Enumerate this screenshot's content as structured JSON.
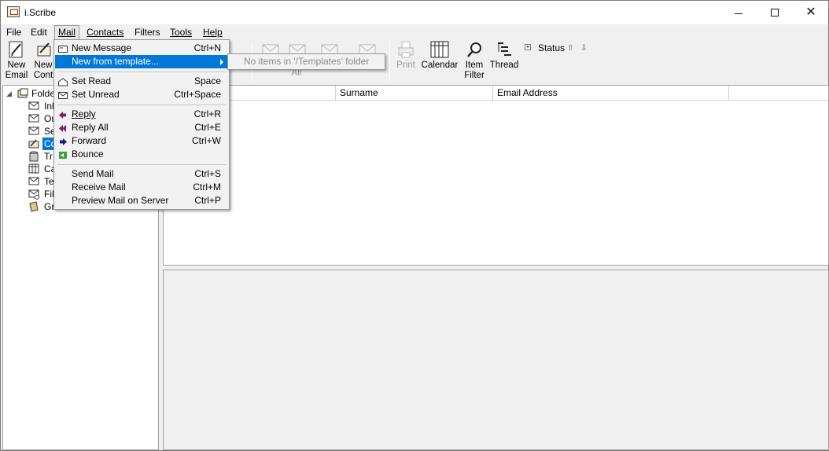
{
  "window": {
    "title": "i.Scribe"
  },
  "menubar": [
    "File",
    "Edit",
    "Mail",
    "Contacts",
    "Filters",
    "Tools",
    "Help"
  ],
  "toolbar": {
    "new_email": [
      "New",
      "Email"
    ],
    "new_contact": [
      "New",
      "Cont"
    ],
    "all_label": "All",
    "print": "Print",
    "calendar": "Calendar",
    "item_filter": [
      "Item",
      "Filter"
    ],
    "thread": "Thread",
    "status": "Status"
  },
  "tree": {
    "root": "Folde",
    "items": [
      "Inb",
      "Ou",
      "Se",
      "Co",
      "Tr",
      "Ca",
      "Te",
      "Fil",
      "Gr"
    ]
  },
  "list": {
    "columns": [
      "Surname",
      "Email Address"
    ]
  },
  "mail_menu": {
    "groups": [
      [
        {
          "label": "New Message",
          "shortcut": "Ctrl+N",
          "icon": "envelope-icon"
        },
        {
          "label": "New from template...",
          "shortcut": "",
          "icon": "",
          "highlighted": true,
          "submenu": true
        }
      ],
      [
        {
          "label": "Set Read",
          "shortcut": "Space",
          "icon": "open-envelope-icon"
        },
        {
          "label": "Set Unread",
          "shortcut": "Ctrl+Space",
          "icon": "closed-envelope-icon"
        }
      ],
      [
        {
          "label": "Reply",
          "shortcut": "Ctrl+R",
          "icon": "reply-icon"
        },
        {
          "label": "Reply All",
          "shortcut": "Ctrl+E",
          "icon": "reply-all-icon"
        },
        {
          "label": "Forward",
          "shortcut": "Ctrl+W",
          "icon": "forward-icon"
        },
        {
          "label": "Bounce",
          "shortcut": "",
          "icon": "bounce-icon"
        }
      ],
      [
        {
          "label": "Send Mail",
          "shortcut": "Ctrl+S",
          "icon": ""
        },
        {
          "label": "Receive Mail",
          "shortcut": "Ctrl+M",
          "icon": ""
        },
        {
          "label": "Preview Mail on Server",
          "shortcut": "Ctrl+P",
          "icon": ""
        }
      ]
    ]
  },
  "template_submenu": {
    "text": "No items in '/Templates' folder"
  },
  "colors": {
    "highlight": "#0078d7",
    "panel_border": "#a0a0a0"
  }
}
